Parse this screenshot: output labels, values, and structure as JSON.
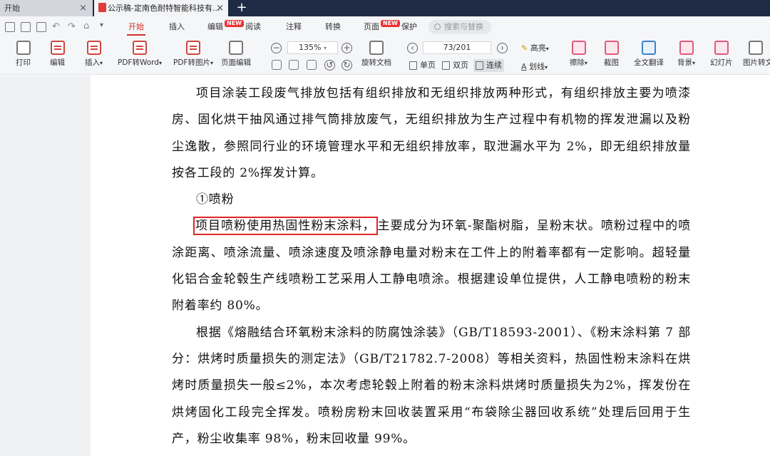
{
  "tabs": {
    "home": "开始",
    "doc": "公示稿-定南色耐特智能科技有..."
  },
  "menu": {
    "items": [
      "开始",
      "插入",
      "编辑",
      "阅读",
      "注释",
      "转换",
      "页面",
      "保护"
    ],
    "new_badge": "NEW",
    "search_placeholder": "搜索与替换"
  },
  "toolbar": {
    "print": "打印",
    "edit": "编辑",
    "insert": "插入",
    "pdf_to_word": "PDF转Word",
    "pdf_to_image": "PDF转图片",
    "page_edit": "页面编辑",
    "zoom": "135%",
    "page_indicator": "73/201",
    "rotate": "旋转文档",
    "single_page": "单页",
    "double_page": "双页",
    "continuous": "连续",
    "highlight": "高亮",
    "underline": "划线",
    "erase": "擦除",
    "screenshot": "截图",
    "translate": "全文翻译",
    "background": "背景",
    "slideshow": "幻灯片",
    "image_convert": "图片转文"
  },
  "document": {
    "p1": "项目涂装工段废气排放包括有组织排放和无组织排放两种形式，有组织排放主要为喷漆房、固化烘干抽风通过排气筒排放废气，无组织排放为生产过程中有机物的挥发泄漏以及粉尘逸散，参照同行业的环境管理水平和无组织排放率，取泄漏水平为 2%，即无组织排放量按各工段的 2%挥发计算。",
    "heading": "①喷粉",
    "p2_highlight": "项目喷粉使用热固性粉末涂料，",
    "p2_rest": "主要成分为环氧-聚酯树脂，呈粉末状。喷粉过程中的喷涂距离、喷涂流量、喷涂速度及喷涂静电量对粉末在工件上的附着率都有一定影响。超轻量化铝合金轮毂生产线喷粉工艺采用人工静电喷涂。根据建设单位提供，人工静电喷粉的粉末附着率约 80%。",
    "p3": "根据《熔融结合环氧粉末涂料的防腐蚀涂装》（GB/T18593-2001）、《粉末涂料第 7 部分：烘烤时质量损失的测定法》（GB/T21782.7-2008）等相关资料，热固性粉末涂料在烘烤时质量损失一般≤2%，本次考虑轮毂上附着的粉末涂料烘烤时质量损失为2%，挥发份在烘烤固化工段完全挥发。喷粉房粉末回收装置采用“布袋除尘器回收系统”处理后回用于生产，粉尘收集率 98%，粉末回收量 99%。"
  }
}
